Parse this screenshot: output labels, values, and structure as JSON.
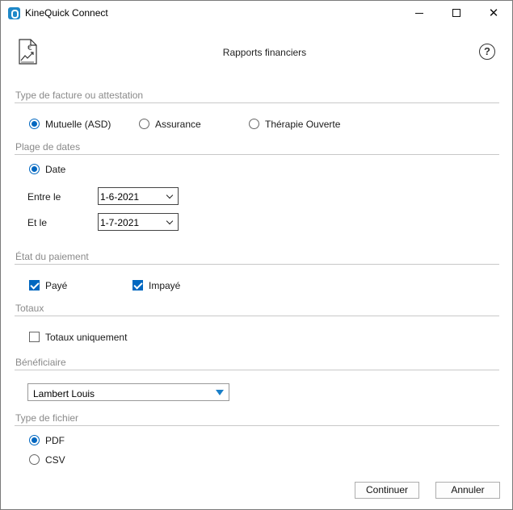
{
  "window": {
    "app_title": "KineQuick Connect",
    "minimize_icon": "minimize-icon",
    "maximize_icon": "maximize-icon",
    "close_icon": "close-icon",
    "close_glyph": "✕"
  },
  "header": {
    "title": "Rapports financiers",
    "report_icon": "financial-report-icon",
    "help_glyph": "?"
  },
  "invoice_type": {
    "label": "Type de facture ou attestation",
    "options": [
      {
        "label": "Mutuelle (ASD)",
        "checked": true
      },
      {
        "label": "Assurance",
        "checked": false
      },
      {
        "label": "Thérapie Ouverte",
        "checked": false
      }
    ]
  },
  "date_range": {
    "label": "Plage de dates",
    "mode_label": "Date",
    "between_label": "Entre le",
    "between_value": "1-6-2021",
    "and_label": "Et le",
    "and_value": "1-7-2021"
  },
  "payment_status": {
    "label": "État du paiement",
    "options": [
      {
        "label": "Payé",
        "checked": true
      },
      {
        "label": "Impayé",
        "checked": true
      }
    ]
  },
  "totals": {
    "label": "Totaux",
    "only_totals_label": "Totaux uniquement",
    "only_totals_checked": false
  },
  "beneficiary": {
    "label": "Bénéficiaire",
    "selected": "Lambert Louis"
  },
  "file_type": {
    "label": "Type de fichier",
    "options": [
      {
        "label": "PDF",
        "checked": true
      },
      {
        "label": "CSV",
        "checked": false
      }
    ]
  },
  "actions": {
    "continue_label": "Continuer",
    "cancel_label": "Annuler"
  },
  "colors": {
    "accent": "#0067c0",
    "section_label": "#8a8a8a",
    "divider": "#c8c8c8",
    "dropdown_arrow": "#1a7fc8"
  }
}
